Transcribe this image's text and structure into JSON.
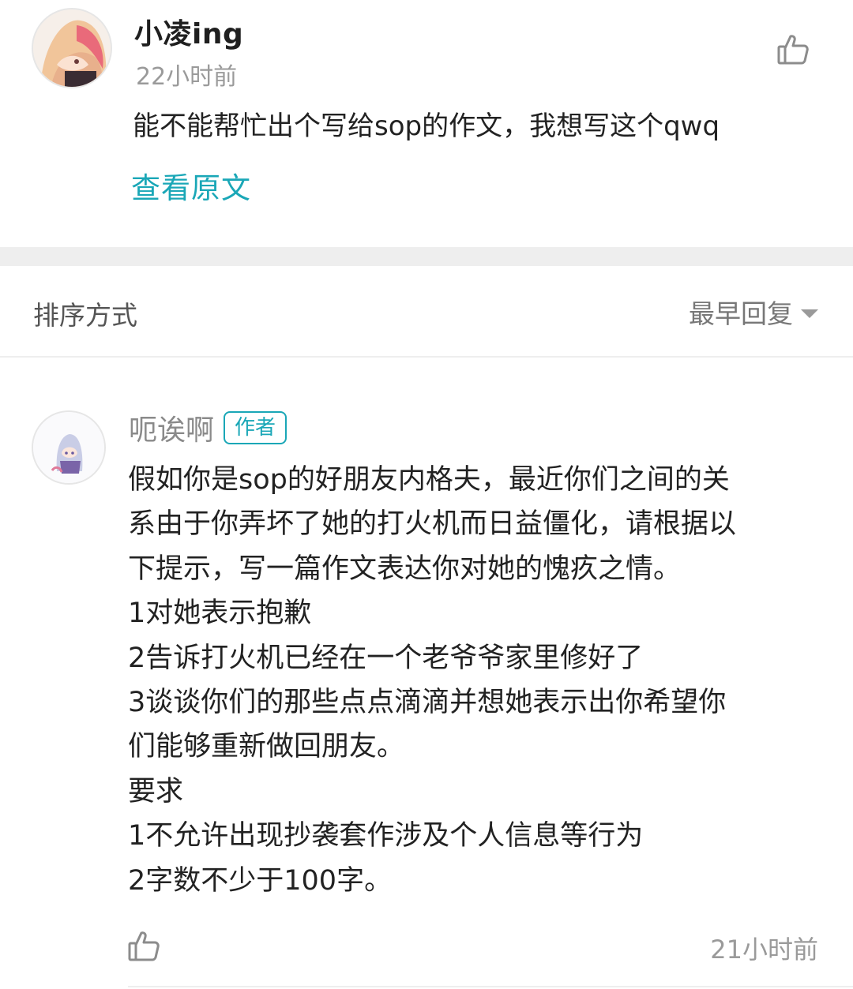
{
  "comment": {
    "username": "小凌ing",
    "time": "22小时前",
    "text": "能不能帮忙出个写给sop的作文，我想写这个qwq",
    "view_original": "查看原文",
    "avatar_icon": "anime-girl-avatar",
    "like_icon": "thumbs-up-icon"
  },
  "sort": {
    "label": "排序方式",
    "value": "最早回复",
    "caret_icon": "caret-down-icon"
  },
  "reply": {
    "username": "呃诶啊",
    "badge": "作者",
    "avatar_icon": "anime-girl-avatar",
    "lines": [
      "假如你是sop的好朋友内格夫，最近你们之间的关",
      "系由于你弄坏了她的打火机而日益僵化，请根据以",
      "下提示，写一篇作文表达你对她的愧疚之情。",
      "1对她表示抱歉",
      "2告诉打火机已经在一个老爷爷家里修好了",
      "3谈谈你们的那些点点滴滴并想她表示出你希望你",
      "们能够重新做回朋友。",
      "要求",
      "1不允许出现抄袭套作涉及个人信息等行为",
      "2字数不少于100字。"
    ],
    "time": "21小时前",
    "like_icon": "thumbs-up-icon"
  },
  "colors": {
    "accent": "#1aa7b7",
    "muted_text": "#9a9a9a",
    "divider": "#eeeeee"
  }
}
